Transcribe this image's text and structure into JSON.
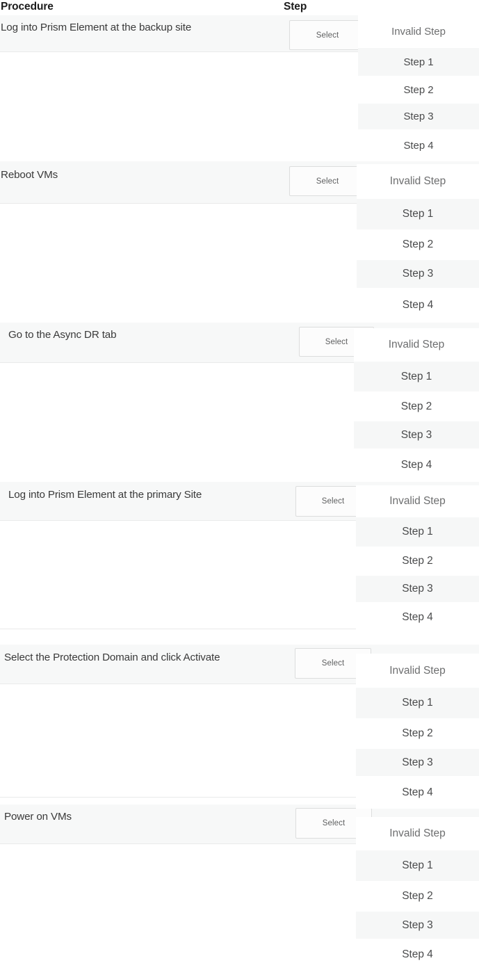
{
  "table": {
    "columns": {
      "procedure": "Procedure",
      "step": "Step"
    },
    "rows": [
      {
        "procedure": "Log into Prism Element at the backup site",
        "select_label": "Select",
        "options": [
          "Invalid Step",
          "Step 1",
          "Step 2",
          "Step 3",
          "Step 4"
        ]
      },
      {
        "procedure": "Reboot VMs",
        "select_label": "Select",
        "options": [
          "Invalid Step",
          "Step 1",
          "Step 2",
          "Step 3",
          "Step 4"
        ]
      },
      {
        "procedure": "Go to the Async DR tab",
        "select_label": "Select",
        "options": [
          "Invalid Step",
          "Step 1",
          "Step 2",
          "Step 3",
          "Step 4"
        ]
      },
      {
        "procedure": "Log into Prism Element at the primary Site",
        "select_label": "Select",
        "options": [
          "Invalid Step",
          "Step 1",
          "Step 2",
          "Step 3",
          "Step 4"
        ]
      },
      {
        "procedure": "Select the Protection Domain and click Activate",
        "select_label": "Select",
        "options": [
          "Invalid Step",
          "Step 1",
          "Step 2",
          "Step 3",
          "Step 4"
        ]
      },
      {
        "procedure": "Power on VMs",
        "select_label": "Select",
        "options": [
          "Invalid Step",
          "Step 1",
          "Step 2",
          "Step 3",
          "Step 4"
        ]
      }
    ]
  },
  "colors": {
    "page_background": "#ffffff",
    "row_band": "#f7f8f8",
    "divider": "#e9eaea",
    "option_alt_background": "#f6f7f7",
    "button_border": "#dcdddd",
    "text": "#3a3a3a",
    "header_text": "#1c1c1c",
    "muted_text": "#6d6e6f"
  }
}
